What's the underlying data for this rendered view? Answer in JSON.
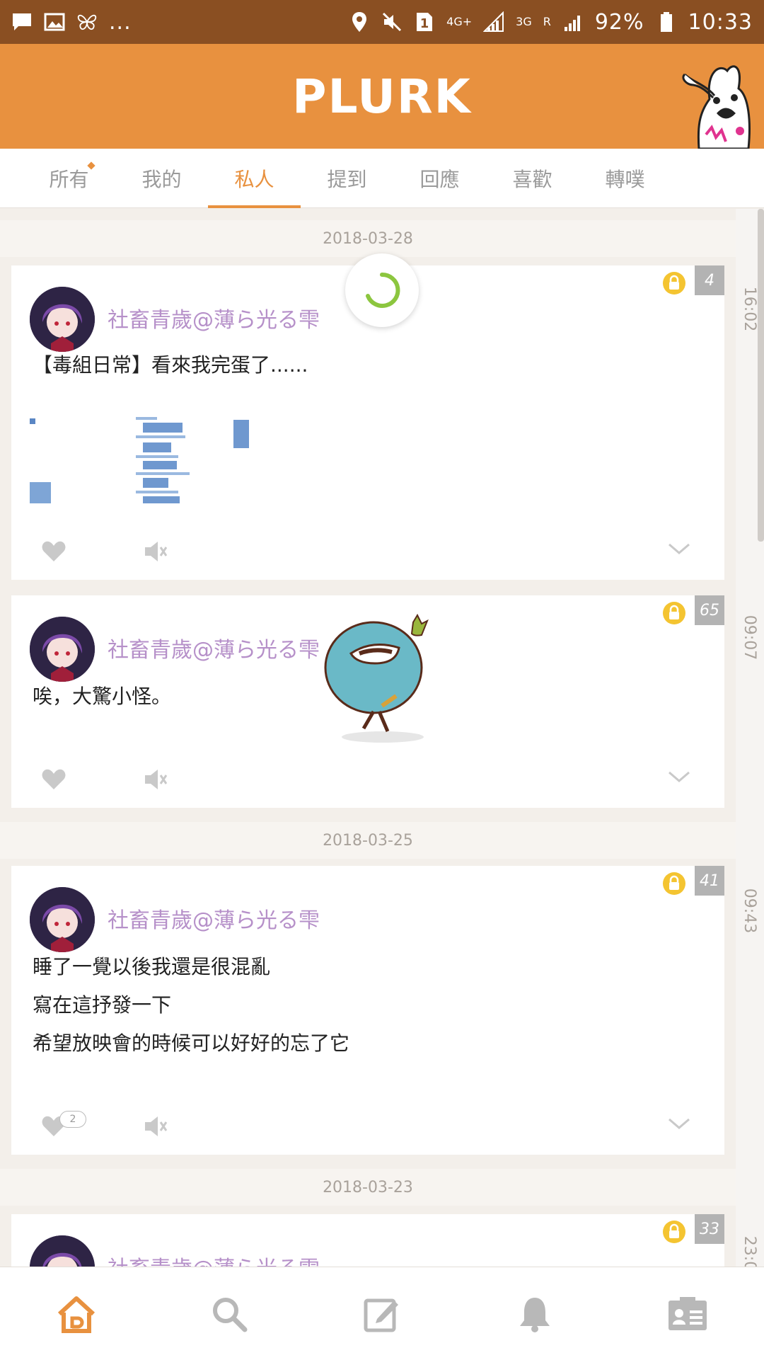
{
  "status_bar": {
    "left_icons": [
      "message-icon",
      "image-icon",
      "butterfly-icon"
    ],
    "more": "...",
    "sim_slot": "1",
    "net_4g": "4G+",
    "net_3g": "3G",
    "roaming": "R",
    "battery": "92%",
    "time": "10:33"
  },
  "header": {
    "logo": "PLURK"
  },
  "tabs": [
    {
      "label": "所有"
    },
    {
      "label": "我的"
    },
    {
      "label": "私人",
      "active": true
    },
    {
      "label": "提到"
    },
    {
      "label": "回應"
    },
    {
      "label": "喜歡"
    },
    {
      "label": "轉噗"
    }
  ],
  "dates": [
    "2018-03-28",
    "2018-03-25",
    "2018-03-23"
  ],
  "rail_times": [
    "16:02",
    "09:07",
    "09:43",
    "23:0"
  ],
  "posts": [
    {
      "nickname": "社畜青歲@薄ら光る雫",
      "content": "【毒組日常】看來我完蛋了......",
      "count": "4"
    },
    {
      "nickname": "社畜青歲@薄ら光る雫",
      "content": "唉，大驚小怪。",
      "count": "65"
    },
    {
      "nickname": "社畜青歲@薄ら光る雫",
      "content": "睡了一覺以後我還是很混亂\n寫在這抒發一下\n希望放映會的時候可以好好的忘了它",
      "count": "41",
      "likes": "2"
    },
    {
      "nickname": "社畜青歲@薄ら光る雫",
      "content": "",
      "count": "33"
    }
  ],
  "colors": {
    "accent": "#e8913f",
    "status_bar": "#8a4f22",
    "nickname": "#b690c9"
  },
  "bottom_nav": [
    "home-icon",
    "search-icon",
    "compose-icon",
    "bell-icon",
    "profile-card-icon"
  ]
}
